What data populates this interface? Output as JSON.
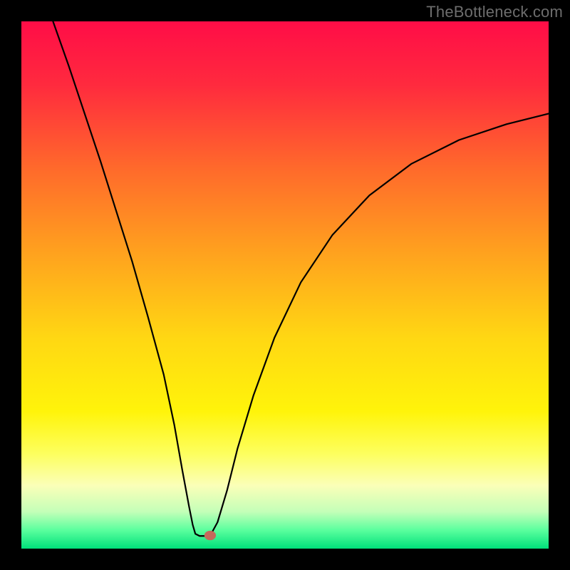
{
  "watermark": "TheBottleneck.com",
  "chart_data": {
    "type": "line",
    "title": "",
    "xlabel": "",
    "ylabel": "",
    "xlim": [
      0,
      1
    ],
    "ylim": [
      0,
      1
    ],
    "background": {
      "type": "vertical-gradient",
      "stops": [
        {
          "pos": 0.0,
          "color": "#ff0d47"
        },
        {
          "pos": 0.12,
          "color": "#ff2a3e"
        },
        {
          "pos": 0.28,
          "color": "#ff6a2b"
        },
        {
          "pos": 0.44,
          "color": "#ffa21e"
        },
        {
          "pos": 0.6,
          "color": "#ffd713"
        },
        {
          "pos": 0.74,
          "color": "#fff40a"
        },
        {
          "pos": 0.82,
          "color": "#fdff5e"
        },
        {
          "pos": 0.88,
          "color": "#fbffb8"
        },
        {
          "pos": 0.93,
          "color": "#c4ffb8"
        },
        {
          "pos": 0.965,
          "color": "#5aff9e"
        },
        {
          "pos": 1.0,
          "color": "#00e07a"
        }
      ]
    },
    "series": [
      {
        "name": "curve",
        "stroke": "#000000",
        "points": [
          {
            "x": 0.06,
            "y": 1.0
          },
          {
            "x": 0.09,
            "y": 0.915
          },
          {
            "x": 0.12,
            "y": 0.825
          },
          {
            "x": 0.15,
            "y": 0.735
          },
          {
            "x": 0.18,
            "y": 0.64
          },
          {
            "x": 0.21,
            "y": 0.545
          },
          {
            "x": 0.24,
            "y": 0.44
          },
          {
            "x": 0.27,
            "y": 0.33
          },
          {
            "x": 0.29,
            "y": 0.235
          },
          {
            "x": 0.305,
            "y": 0.15
          },
          {
            "x": 0.318,
            "y": 0.08
          },
          {
            "x": 0.325,
            "y": 0.045
          },
          {
            "x": 0.33,
            "y": 0.028
          },
          {
            "x": 0.338,
            "y": 0.024
          },
          {
            "x": 0.35,
            "y": 0.024
          },
          {
            "x": 0.36,
            "y": 0.028
          },
          {
            "x": 0.372,
            "y": 0.05
          },
          {
            "x": 0.39,
            "y": 0.11
          },
          {
            "x": 0.41,
            "y": 0.19
          },
          {
            "x": 0.44,
            "y": 0.29
          },
          {
            "x": 0.48,
            "y": 0.4
          },
          {
            "x": 0.53,
            "y": 0.505
          },
          {
            "x": 0.59,
            "y": 0.595
          },
          {
            "x": 0.66,
            "y": 0.67
          },
          {
            "x": 0.74,
            "y": 0.73
          },
          {
            "x": 0.83,
            "y": 0.775
          },
          {
            "x": 0.92,
            "y": 0.805
          },
          {
            "x": 1.0,
            "y": 0.825
          }
        ]
      }
    ],
    "marker": {
      "x": 0.358,
      "y": 0.025,
      "rx": 0.011,
      "ry": 0.009,
      "color": "#c6695b"
    }
  }
}
